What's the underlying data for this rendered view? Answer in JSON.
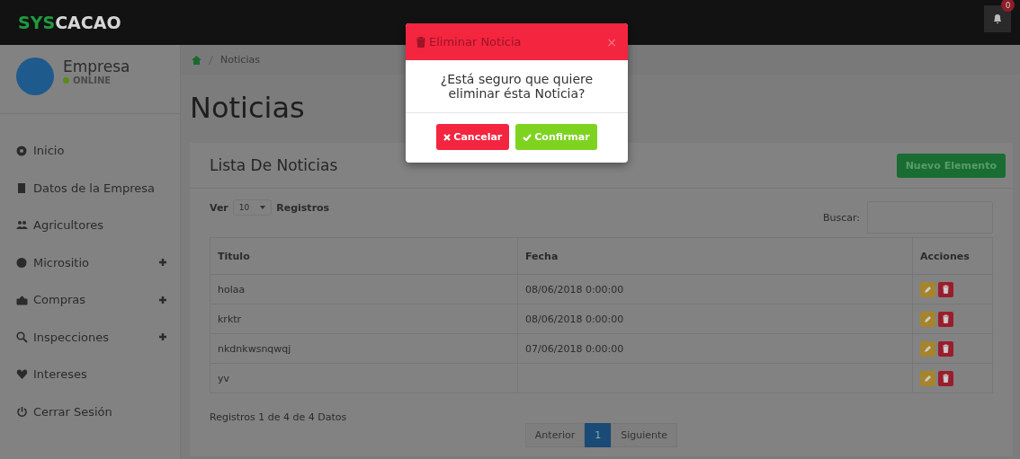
{
  "topbar": {
    "brand_prefix": "SYS",
    "brand_rest": "CACAO",
    "notifications": "0"
  },
  "sidebar": {
    "user": {
      "name": "Empresa",
      "status": "ONLINE",
      "online": true
    },
    "items": [
      {
        "label": "Inicio",
        "expandable": false
      },
      {
        "label": "Datos de la Empresa",
        "expandable": false
      },
      {
        "label": "Agricultores",
        "expandable": false
      },
      {
        "label": "Micrositio",
        "expandable": true
      },
      {
        "label": "Compras",
        "expandable": true
      },
      {
        "label": "Inspecciones",
        "expandable": true
      },
      {
        "label": "Intereses",
        "expandable": false
      },
      {
        "label": "Cerrar Sesión",
        "expandable": false
      }
    ]
  },
  "breadcrumb": [
    "Noticias"
  ],
  "page_title": "Noticias",
  "card": {
    "title": "Lista De Noticias",
    "new_button": "Nuevo Elemento",
    "length_prefix": "Ver",
    "length_value": "10",
    "length_suffix": "Registros",
    "search_label": "Buscar:",
    "columns": [
      "Titulo",
      "Fecha",
      "Acciones"
    ],
    "rows": [
      {
        "titulo": "holaa",
        "fecha": "08/06/2018 0:00:00"
      },
      {
        "titulo": "krktr",
        "fecha": "08/06/2018 0:00:00"
      },
      {
        "titulo": "nkdnkwsnqwqj",
        "fecha": "07/06/2018 0:00:00"
      },
      {
        "titulo": "yv",
        "fecha": ""
      }
    ],
    "info": "Registros 1 de 4 de 4 Datos",
    "pagination": [
      {
        "label": "Anterior",
        "selected": false
      },
      {
        "label": "1",
        "selected": true
      },
      {
        "label": "Siguiente",
        "selected": false
      }
    ]
  },
  "modal": {
    "title": "Eliminar Noticia",
    "close": "×",
    "message": "¿Está seguro que quiere eliminar ésta Noticia?",
    "cancel": "Cancelar",
    "confirm": "Confirmar"
  }
}
